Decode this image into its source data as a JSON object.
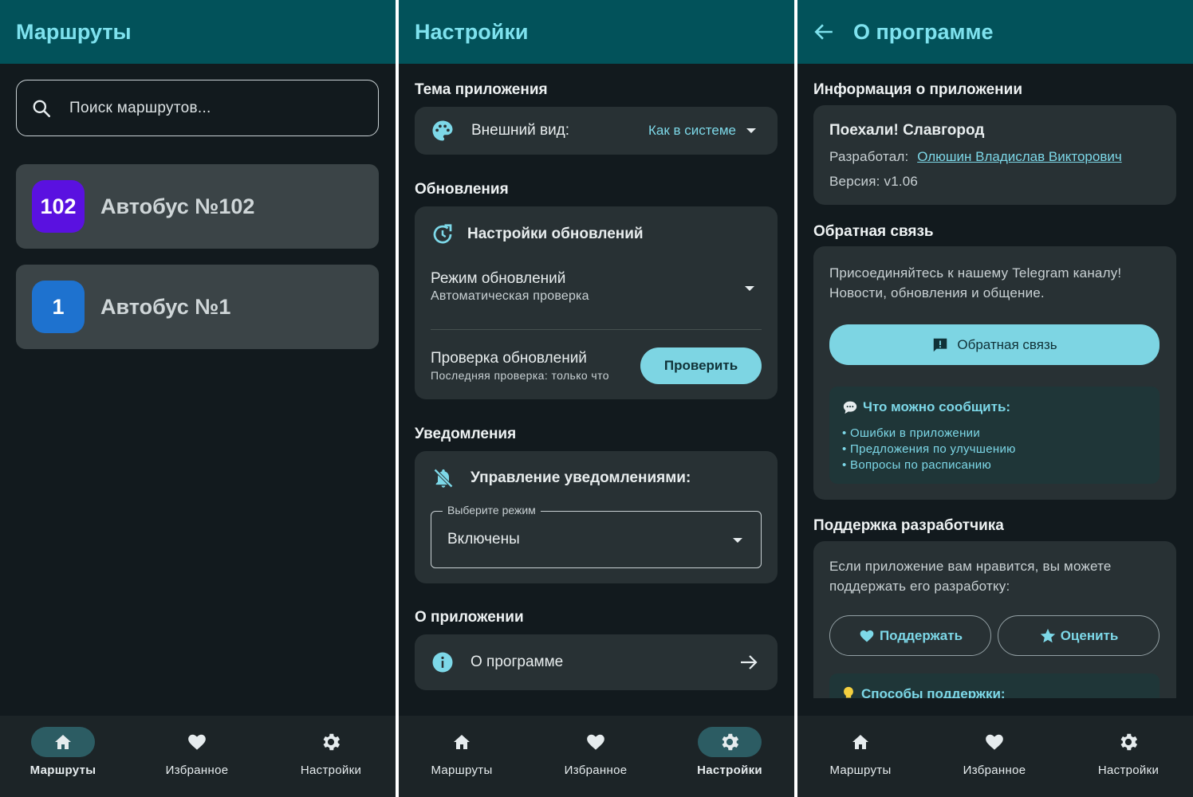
{
  "nav": {
    "routes": "Маршруты",
    "favorites": "Избранное",
    "settings": "Настройки"
  },
  "routes_screen": {
    "title": "Маршруты",
    "search_placeholder": "Поиск маршрутов...",
    "routes": [
      {
        "badge": "102",
        "name": "Автобус №102",
        "color": "#5a11e0"
      },
      {
        "badge": "1",
        "name": "Автобус №1",
        "color": "#1e72cf"
      }
    ]
  },
  "settings_screen": {
    "title": "Настройки",
    "theme_header": "Тема приложения",
    "appearance_label": "Внешний вид:",
    "appearance_value": "Как в системе",
    "updates_header": "Обновления",
    "updates_card_title": "Настройки обновлений",
    "update_mode_label": "Режим обновлений",
    "update_mode_value": "Автоматическая проверка",
    "check_label": "Проверка обновлений",
    "check_sub": "Последняя проверка: только что",
    "check_button": "Проверить",
    "notif_header": "Уведомления",
    "notif_title": "Управление уведомлениями:",
    "notif_select_legend": "Выберите режим",
    "notif_select_value": "Включены",
    "about_header": "О приложении",
    "about_item": "О программе"
  },
  "about_screen": {
    "title": "О программе",
    "info_header": "Информация о приложении",
    "app_name": "Поехали! Славгород",
    "dev_label": "Разработал:",
    "dev_name": "Олюшин Владислав Викторович",
    "version": "Версия: v1.06",
    "feedback_header": "Обратная связь",
    "feedback_text_1": "Присоединяйтесь к нашему Telegram каналу!",
    "feedback_text_2": "Новости, обновления и общение.",
    "feedback_button": "Обратная связь",
    "what_title": "Что можно сообщить:",
    "what_items": [
      "Ошибки в приложении",
      "Предложения по улучшению",
      "Вопросы по расписанию"
    ],
    "support_header": "Поддержка разработчика",
    "support_text_1": "Если приложение вам нравится, вы можете",
    "support_text_2": "поддержать его разработку:",
    "support_button": "Поддержать",
    "rate_button": "Оценить",
    "ways_title": "Способы поддержки:"
  }
}
